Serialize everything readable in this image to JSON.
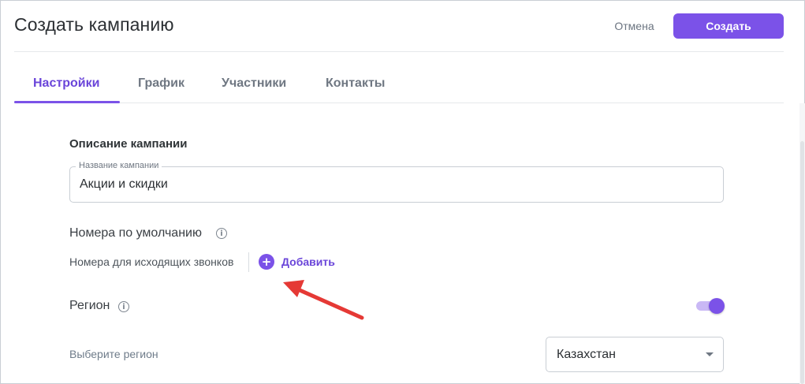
{
  "header": {
    "title": "Создать кампанию",
    "cancel_label": "Отмена",
    "create_label": "Создать"
  },
  "tabs": [
    {
      "label": "Настройки",
      "active": true
    },
    {
      "label": "График",
      "active": false
    },
    {
      "label": "Участники",
      "active": false
    },
    {
      "label": "Контакты",
      "active": false
    }
  ],
  "description": {
    "section_title": "Описание кампании",
    "name_field": {
      "label": "Название кампании",
      "value": "Акции и скидки"
    }
  },
  "default_numbers": {
    "title": "Номера по умолчанию",
    "outgoing_label": "Номера для исходящих звонков",
    "add_label": "Добавить"
  },
  "region": {
    "title": "Регион",
    "toggle_on": true,
    "select_label": "Выберите регион",
    "selected": "Казахстан"
  },
  "colors": {
    "accent": "#7b52e8",
    "annotation_arrow": "#e53935"
  },
  "icons": {
    "info": "info-icon",
    "add": "plus-circle-icon",
    "dropdown": "chevron-down-icon"
  }
}
